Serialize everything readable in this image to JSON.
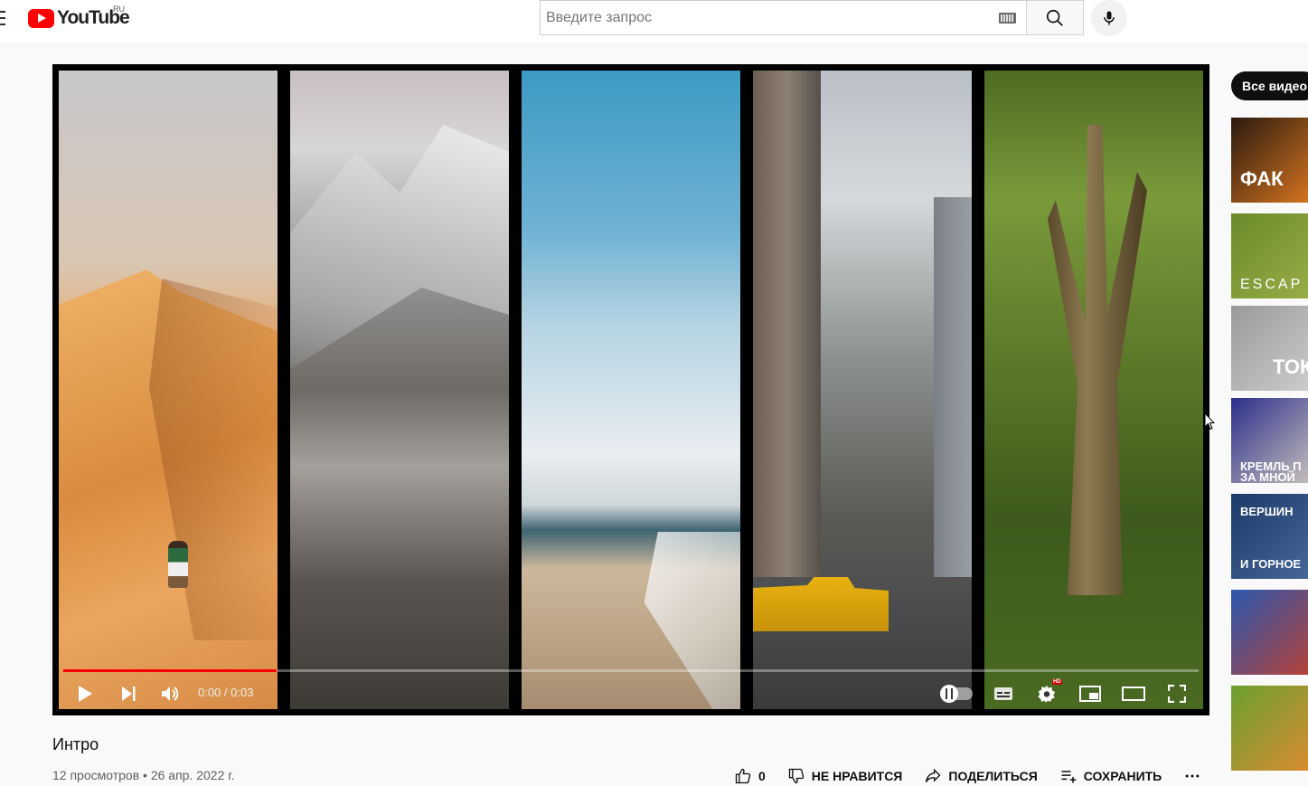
{
  "header": {
    "logo_text": "YouTube",
    "region": "RU",
    "search_placeholder": "Введите запрос"
  },
  "player": {
    "time_display": "0:00 / 0:03",
    "progress_fraction": 0.188,
    "hd_badge": "HD"
  },
  "video": {
    "title": "Интро",
    "meta": "12 просмотров • 26 апр. 2022 г.",
    "likes": "0",
    "dislike_label": "НЕ НРАВИТСЯ",
    "share_label": "ПОДЕЛИТЬСЯ",
    "save_label": "СОХРАНИТЬ"
  },
  "sidebar": {
    "chip_label": "Все видео",
    "thumbs": [
      {
        "text": "ФАК",
        "colors": [
          "#2a1a10",
          "#e07a20"
        ]
      },
      {
        "text": "ESCAP",
        "colors": [
          "#6a8a2a",
          "#9ab04a"
        ]
      },
      {
        "text": "ТОК",
        "colors": [
          "#9a9a9a",
          "#cfcfcf"
        ]
      },
      {
        "text": "КРЕМЛЬ П\nЗА МНОЙ",
        "colors": [
          "#2a2e8a",
          "#d0c8c0"
        ]
      },
      {
        "text": "ВЕРШИН\nИ ГОРНОЕ",
        "colors": [
          "#1c3a6a",
          "#4a6a9a"
        ]
      },
      {
        "text": "",
        "colors": [
          "#2a58b0",
          "#c04030"
        ]
      },
      {
        "text": "",
        "colors": [
          "#6aa030",
          "#e08a30"
        ]
      }
    ]
  }
}
